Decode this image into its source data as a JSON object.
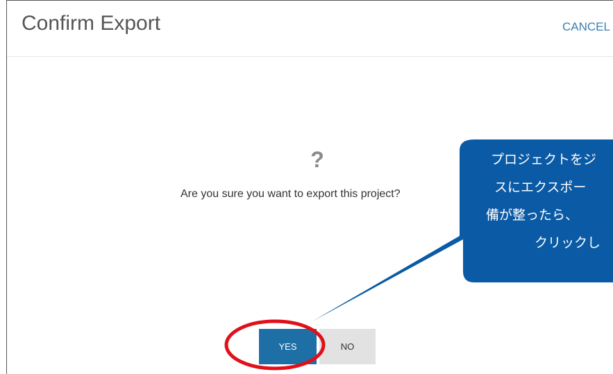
{
  "dialog": {
    "title": "Confirm Export",
    "cancel_label": "CANCEL",
    "question_icon": "?",
    "message": "Are you sure you want to export this project?",
    "yes_label": "YES",
    "no_label": "NO"
  },
  "callout": {
    "lines": [
      "プロジェクトをジ",
      "スにエクスポー",
      "備が整ったら、",
      "クリックし"
    ],
    "color": "#0b5aa5"
  },
  "highlight": {
    "color": "#e0101a"
  }
}
